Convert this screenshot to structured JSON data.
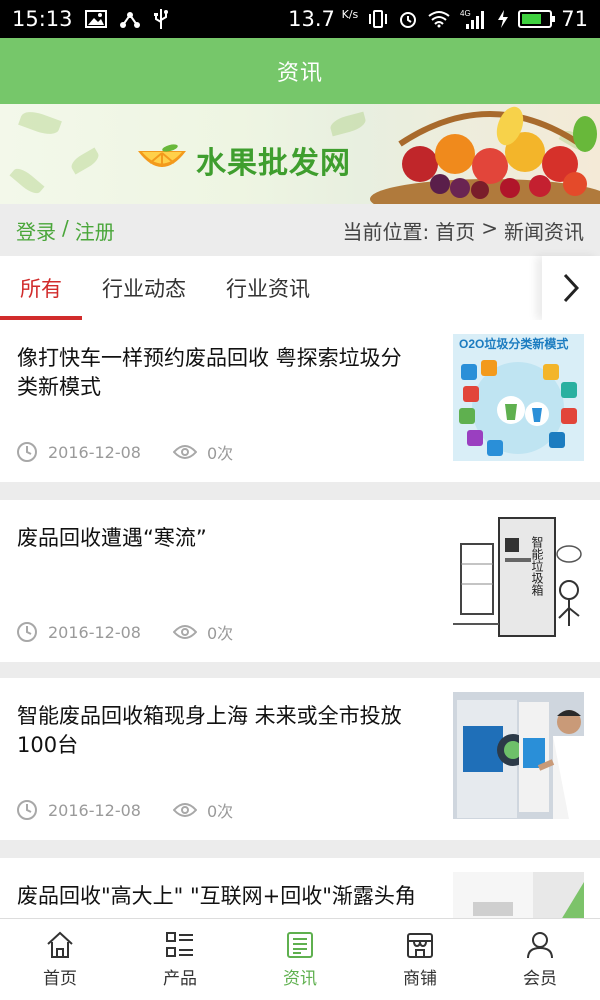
{
  "status_bar": {
    "time": "15:13",
    "speed": "13.7",
    "speed_unit": "K/s",
    "network": "4G",
    "battery": "71",
    "battery_fraction": 0.71
  },
  "header": {
    "title": "资讯"
  },
  "banner": {
    "site_name": "水果批发网"
  },
  "crumb": {
    "login": "登录",
    "separator": "/",
    "register": "注册",
    "prefix": "当前位置:",
    "home": "首页",
    "arrow": ">",
    "current": "新闻资讯"
  },
  "tabs": [
    {
      "label": "所有",
      "active": true
    },
    {
      "label": "行业动态",
      "active": false
    },
    {
      "label": "行业资讯",
      "active": false
    }
  ],
  "news": [
    {
      "title": "像打快车一样预约废品回收 粤探索垃圾分类新模式",
      "date": "2016-12-08",
      "views": "0次"
    },
    {
      "title": "废品回收遭遇“寒流”",
      "date": "2016-12-08",
      "views": "0次"
    },
    {
      "title": "智能废品回收箱现身上海 未来或全市投放100台",
      "date": "2016-12-08",
      "views": "0次"
    },
    {
      "title": "废品回收\"高大上\" \"互联网+回收\"渐露头角",
      "date": "",
      "views": ""
    }
  ],
  "thumb_text": {
    "o2o_heading": "O2O垃圾分类新模式",
    "smart_bin": "智能垃圾箱"
  },
  "bottom_nav": [
    {
      "label": "首页",
      "icon": "home-icon",
      "active": false
    },
    {
      "label": "产品",
      "icon": "list-icon",
      "active": false
    },
    {
      "label": "资讯",
      "icon": "news-icon",
      "active": true
    },
    {
      "label": "商铺",
      "icon": "shop-icon",
      "active": false
    },
    {
      "label": "会员",
      "icon": "user-icon",
      "active": false
    }
  ],
  "colors": {
    "header_green": "#76c76a",
    "accent_green": "#4aa63a",
    "tab_active_red": "#d12b2b",
    "nav_active_green": "#5fb04f"
  }
}
